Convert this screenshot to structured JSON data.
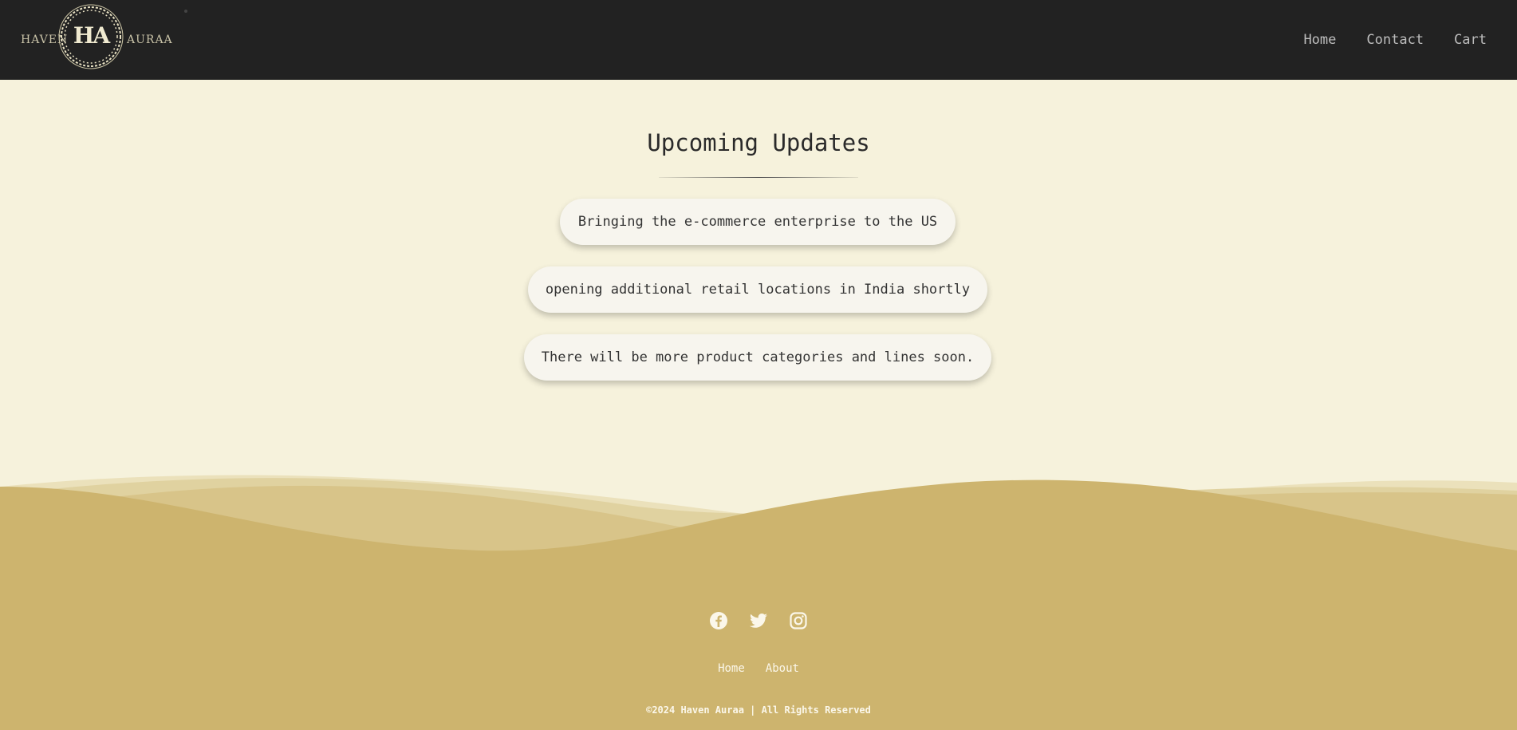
{
  "header": {
    "brand_left": "HAVEN",
    "brand_right": "AURAA",
    "brand_mark": "HA",
    "nav": [
      {
        "label": "Home"
      },
      {
        "label": "Contact"
      },
      {
        "label": "Cart"
      }
    ]
  },
  "main": {
    "title": "Upcoming Updates",
    "updates": [
      {
        "text": "Bringing the e-commerce enterprise to the US"
      },
      {
        "text": "opening additional retail locations in India shortly"
      },
      {
        "text": "There will be more product categories and lines soon."
      }
    ]
  },
  "footer": {
    "social_icons": [
      "facebook-icon",
      "twitter-icon",
      "instagram-icon"
    ],
    "links": [
      {
        "label": "Home"
      },
      {
        "label": "About"
      }
    ],
    "copyright": "©2024 Haven Auraa | All Rights Reserved"
  },
  "colors": {
    "header_bg": "#222222",
    "page_bg": "#f6f2dc",
    "sand": "#cdb46e",
    "pill_bg": "#f7f5ee"
  }
}
